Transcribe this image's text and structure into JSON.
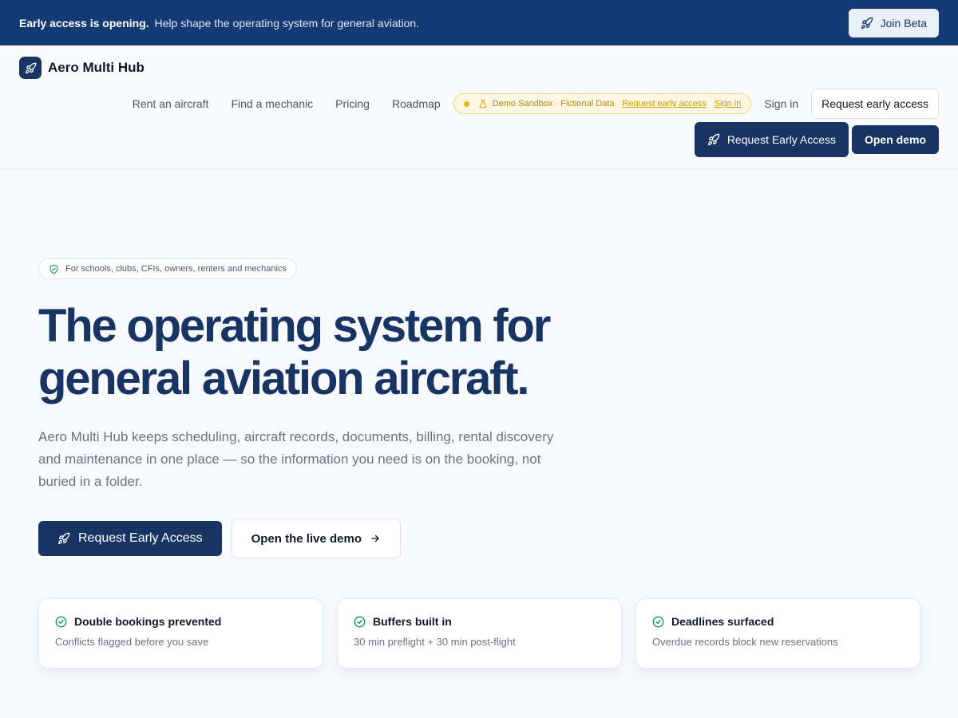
{
  "announcement": {
    "bold": "Early access is opening.",
    "text": "Help shape the operating system for general aviation.",
    "button_label": "Join Beta"
  },
  "brand": {
    "name": "Aero Multi Hub"
  },
  "nav": {
    "links": [
      "Rent an aircraft",
      "Find a mechanic",
      "Pricing",
      "Roadmap"
    ],
    "sandbox": {
      "label": "Demo Sandbox · Fictional Data",
      "request_link": "Request early access",
      "signin_link": "Sign in"
    },
    "signin": "Sign in",
    "request_access": "Request early access",
    "cta_primary": "Request Early Access",
    "cta_demo": "Open demo"
  },
  "hero": {
    "pill": "For schools, clubs, CFIs, owners, renters and mechanics",
    "title": "The operating system for general aviation aircraft.",
    "subtitle": "Aero Multi Hub keeps scheduling, aircraft records, documents, billing, rental discovery and maintenance in one place — so the information you need is on the booking, not buried in a folder.",
    "cta_primary": "Request Early Access",
    "cta_secondary": "Open the live demo"
  },
  "features": [
    {
      "title": "Double bookings prevented",
      "desc": "Conflicts flagged before you save"
    },
    {
      "title": "Buffers built in",
      "desc": "30 min preflight + 30 min post-flight"
    },
    {
      "title": "Deadlines surfaced",
      "desc": "Overdue records block new reservations"
    }
  ],
  "colors": {
    "navy": "#173463",
    "announcement_bg": "#143a74",
    "check_green": "#15935f",
    "sandbox_amber": "#f0b400"
  },
  "icons": {
    "rocket": "rocket-icon",
    "shield": "shield-check-icon",
    "check": "check-circle-icon",
    "arrow": "arrow-right-icon",
    "flask": "flask-icon"
  }
}
